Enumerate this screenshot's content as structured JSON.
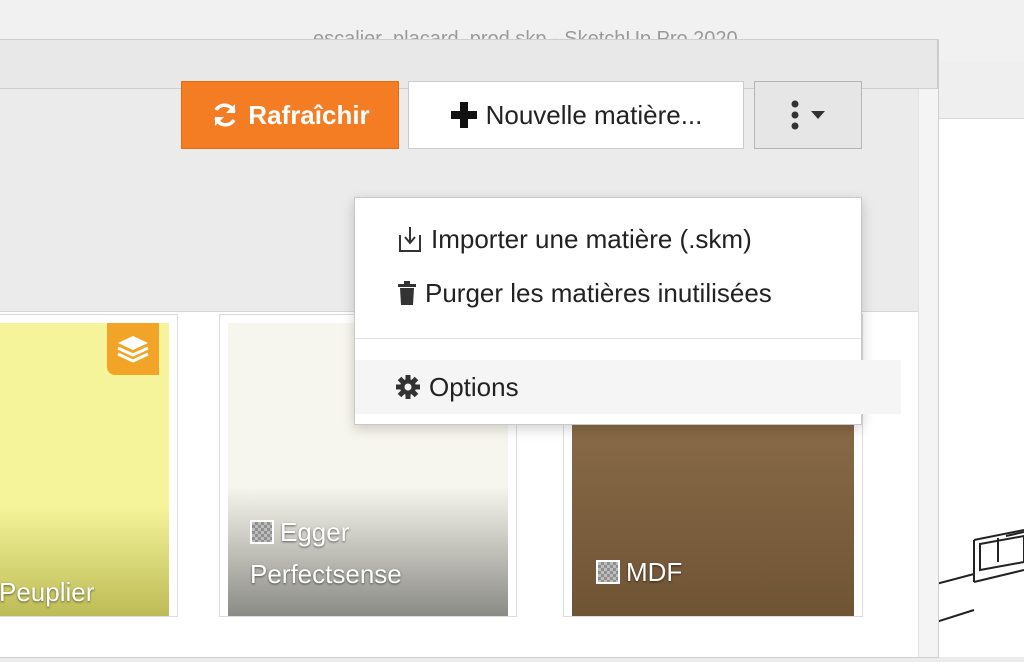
{
  "window": {
    "title": "escalier_placard_prod.skp - SketchUp Pro 2020"
  },
  "toolbar": {
    "refresh_label": "Rafraîchir",
    "new_material_label": "Nouvelle matière...",
    "accent_color": "#f47c22"
  },
  "menu": {
    "items": [
      {
        "label": "Importer une matière (.skm)",
        "icon": "import-icon"
      },
      {
        "label": "Purger les matières inutilisées",
        "icon": "trash-icon"
      },
      {
        "label": "Options",
        "icon": "gear-icon"
      }
    ]
  },
  "materials": [
    {
      "name": "Peuplier",
      "color": "#f6f49a",
      "icon": "layers-icon"
    },
    {
      "name_line1": "Egger",
      "name_line2": "Perfectsense",
      "color": "#f7f6ee",
      "icon": "texture-icon"
    },
    {
      "name": "MDF",
      "color": "#8a6a45",
      "icon": "texture-icon"
    }
  ]
}
